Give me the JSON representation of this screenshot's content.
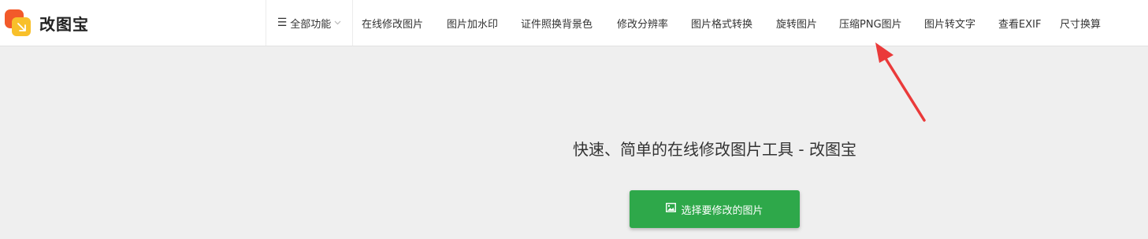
{
  "brand": {
    "name": "改图宝"
  },
  "nav": {
    "all_label": "全部功能",
    "items": [
      "在线修改图片",
      "图片加水印",
      "证件照换背景色",
      "修改分辨率",
      "图片格式转换",
      "旋转图片",
      "压缩PNG图片",
      "图片转文字",
      "查看EXIF",
      "尺寸换算"
    ]
  },
  "main": {
    "headline": "快速、简单的在线修改图片工具 - 改图宝",
    "cta_label": "选择要修改的图片"
  },
  "icons": {
    "menu": "menu-icon",
    "chevron": "chevron-down-icon",
    "image": "image-icon"
  },
  "colors": {
    "brand_primary": "#f25a2a",
    "brand_secondary": "#f8c02a",
    "cta": "#2ea84a",
    "annotation_arrow": "#ea3a3a"
  }
}
